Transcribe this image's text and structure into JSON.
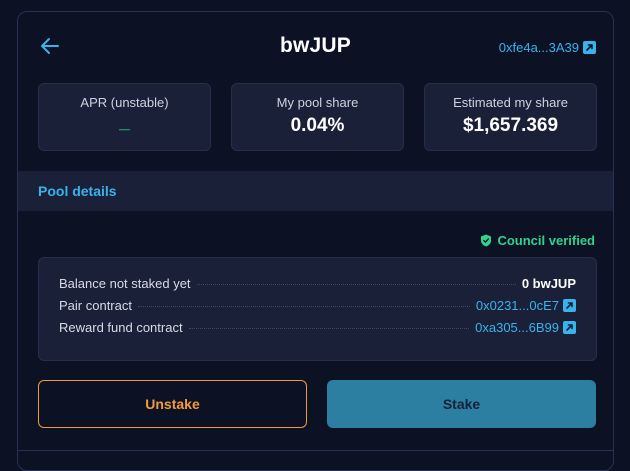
{
  "header": {
    "title": "bwJUP",
    "contract_address": "0xfe4a...3A39"
  },
  "stats": [
    {
      "label": "APR (unstable)",
      "value": "_"
    },
    {
      "label": "My pool share",
      "value": "0.04%"
    },
    {
      "label": "Estimated my share",
      "value": "$1,657.369"
    }
  ],
  "pool_details": {
    "title": "Pool details",
    "verified_label": "Council verified",
    "rows": [
      {
        "label": "Balance not staked yet",
        "value": "0 bwJUP"
      },
      {
        "label": "Pair contract",
        "value": "0x0231...0cE7"
      },
      {
        "label": "Reward fund contract",
        "value": "0xa305...6B99"
      }
    ]
  },
  "actions": {
    "unstake_label": "Unstake",
    "stake_label": "Stake"
  },
  "colors": {
    "background": "#0c1124",
    "card": "#1a2038",
    "accent_blue": "#39b3ec",
    "accent_green": "#2fd38c",
    "accent_orange": "#f29a3c",
    "stake_button": "#2d7fa1"
  },
  "icons": {
    "back": "arrow-left-icon",
    "external": "external-link-icon",
    "verified": "shield-check-icon"
  }
}
